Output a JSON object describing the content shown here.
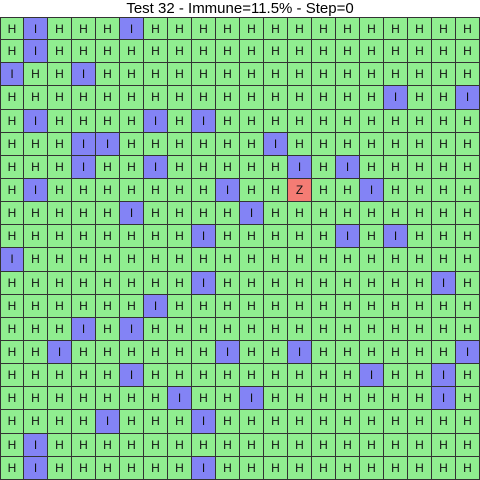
{
  "title": "Test 32 - Immune=11.5% - Step=0",
  "colors": {
    "H": "#90ee90",
    "I": "#8383f5",
    "Z": "#f47c74"
  },
  "grid": {
    "rows": [
      "HIHHHIHHHHHHHHHHHHHH",
      "HIHHHHHHHHHHHHHHHHHH",
      "IHHIHHHHHHHHHHHHHHHH",
      "HHHHHHHHHHHHHHHHIHHI",
      "HIHHHHIHIHHHHHHHHHHH",
      "HHHIIHHHHHHIHHHHHHHH",
      "HHHIHHIHHHHHIHIHHHHH",
      "HIHHHHHHHIHHZHHIHHHH",
      "HHHHHIHHHHIHHHHHHHHH",
      "HHHHHHHHIHHHHHIHIHHH",
      "IHHHHHHHHHHHHHHHHHHH",
      "HHHHHHHHIHHHHHHHHHIH",
      "HHHHHHIHHHHHHHHHHHHH",
      "HHHIHIHHHHHHHHHHHHHH",
      "HHIHHHHHHIHHIHHHHHHI",
      "HHHHHIHHHHHHHHHIHHIH",
      "HHHHHHHIHHIHHHHHHHIH",
      "HHHHIHHHIHHHHHHHHHHH",
      "HIHHHHHHHHHHHHHHHHHH",
      "HIHHHHHHIHHHHHHHHHHH"
    ]
  }
}
